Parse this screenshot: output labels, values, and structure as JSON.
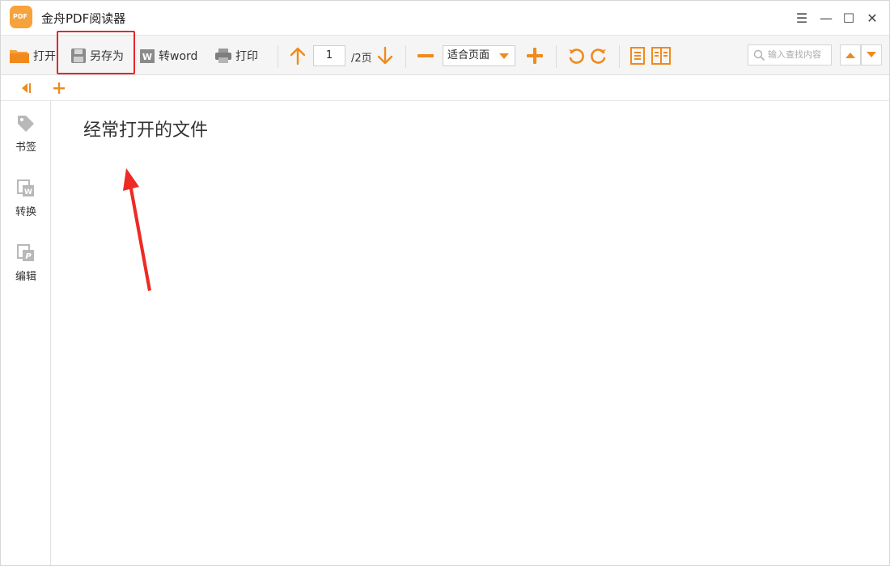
{
  "app": {
    "title": "金舟PDF阅读器",
    "logo_text": "PDF"
  },
  "window_controls": {
    "menu": "☰",
    "minimize": "—",
    "maximize": "☐",
    "close": "✕"
  },
  "toolbar": {
    "open_label": "打开",
    "save_as_label": "另存为",
    "to_word_label": "转word",
    "print_label": "打印",
    "current_page": "1",
    "total_pages": "/2页",
    "zoom_value": "适合页面",
    "search_placeholder": "输入查找内容"
  },
  "sidebar": {
    "items": [
      {
        "label": "书签",
        "icon": "tag-icon"
      },
      {
        "label": "转换",
        "icon": "convert-word-icon"
      },
      {
        "label": "编辑",
        "icon": "edit-pdf-icon"
      }
    ]
  },
  "main": {
    "title": "经常打开的文件"
  },
  "colors": {
    "accent": "#f08a1c",
    "highlight": "#e8262a"
  }
}
